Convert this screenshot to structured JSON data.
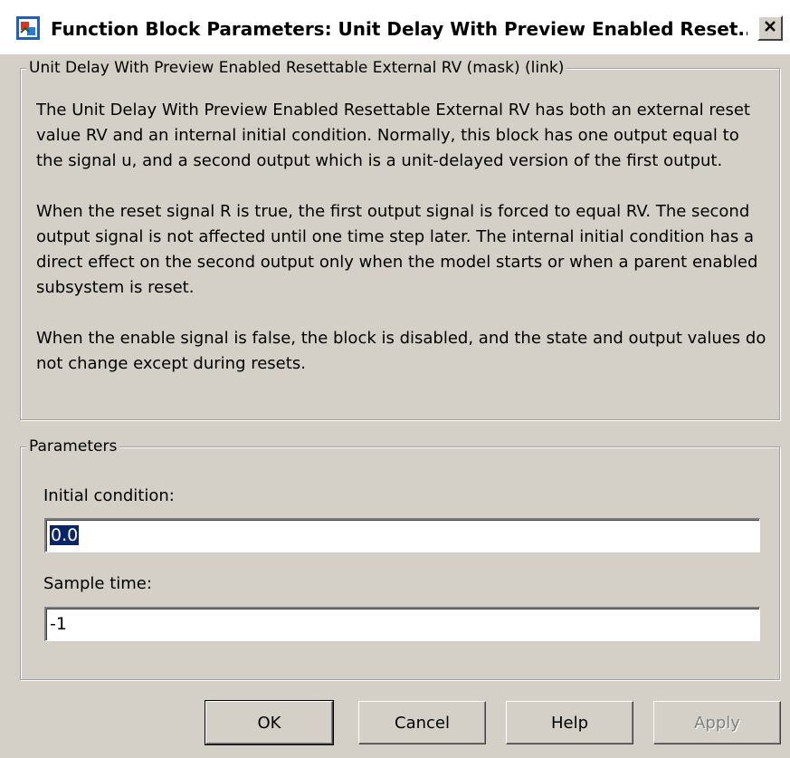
{
  "window": {
    "title": "Function Block Parameters: Unit Delay With Preview Enabled Reset...",
    "title_icon": "simulink-block-icon",
    "close_icon": "close-icon"
  },
  "description_group": {
    "legend": "Unit Delay With Preview Enabled Resettable External RV (mask) (link)",
    "paragraphs": [
      "The Unit Delay With Preview Enabled Resettable External RV has both an external reset value RV and an internal initial condition. Normally, this block has one output equal to the signal u, and a second output which is a unit-delayed version of the first output.",
      "When the reset signal R is true, the first output signal is forced to equal RV. The second output signal is not affected until one time step later. The internal initial condition has a direct effect on the second output only when the model starts or when a parent enabled subsystem is reset.",
      "When the enable signal is false, the block is disabled, and the state and output values do not change except during resets."
    ]
  },
  "parameters_group": {
    "legend": "Parameters",
    "initial_condition": {
      "label": "Initial condition:",
      "value": "0.0"
    },
    "sample_time": {
      "label": "Sample time:",
      "value": "-1"
    }
  },
  "buttons": {
    "ok": "OK",
    "cancel": "Cancel",
    "help": "Help",
    "apply": "Apply"
  },
  "colors": {
    "dialog_bg": "#d4d0c8",
    "selection_bg": "#0a246a",
    "disabled_text": "#808080"
  }
}
